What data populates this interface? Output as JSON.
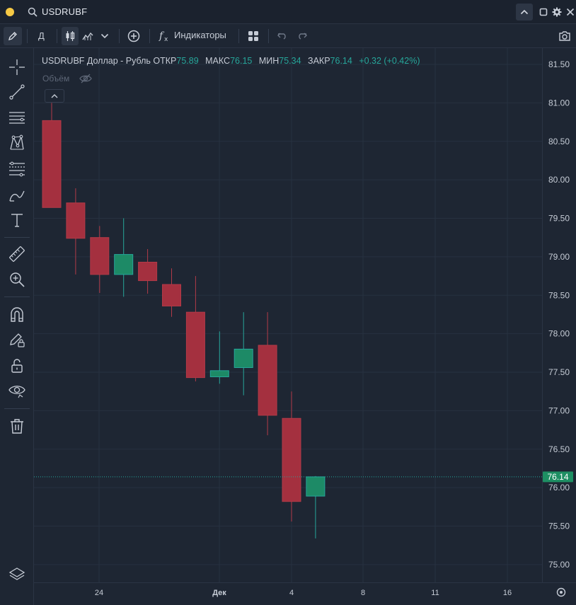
{
  "header": {
    "symbol": "USDRUBF"
  },
  "toolbar": {
    "timeframe": "Д",
    "indicators_label": "Индикаторы"
  },
  "legend": {
    "title": "USDRUBF Доллар - Рубль",
    "open_label": "ОТКР",
    "open_value": "75.89",
    "high_label": "МАКС",
    "high_value": "76.15",
    "low_label": "МИН",
    "low_value": "75.34",
    "close_label": "ЗАКР",
    "close_value": "76.14",
    "change": "+0.32 (+0.42%)",
    "volume_label": "Объём"
  },
  "colors": {
    "up": "#26a69a",
    "down": "#b23a48",
    "background": "#1e2633",
    "grid": "#273140",
    "last_price_tag": "#1e8f63"
  },
  "icons": {
    "top": [
      "search-icon",
      "chevron-up-icon",
      "maximize-icon",
      "settings-icon",
      "close-icon"
    ],
    "toolbar": [
      "pencil-icon",
      "candles-icon",
      "area-chart-icon",
      "chevron-down-icon",
      "plus-circle-icon",
      "fx-icon",
      "layout-grid-icon",
      "undo-icon",
      "redo-icon",
      "camera-icon"
    ],
    "left": [
      "crosshair-icon",
      "trend-line-icon",
      "horizontal-lines-icon",
      "pattern-icon",
      "fib-levels-icon",
      "brush-icon",
      "text-icon",
      "ruler-icon",
      "zoom-icon",
      "magnet-icon",
      "lock-drawing-icon",
      "unlock-icon",
      "eye-icon",
      "trash-icon",
      "layers-icon"
    ]
  },
  "chart_data": {
    "type": "candlestick",
    "symbol": "USDRUBF",
    "y_axis_ticks": [
      "81.50",
      "81.00",
      "80.50",
      "80.00",
      "79.50",
      "79.00",
      "78.50",
      "78.00",
      "77.50",
      "77.00",
      "76.50",
      "76.00",
      "75.50",
      "75.00"
    ],
    "x_axis_ticks": [
      "24",
      "Дек",
      "4",
      "8",
      "11",
      "16"
    ],
    "ylim": [
      75.0,
      81.5
    ],
    "last_price": "76.14",
    "candles": [
      {
        "open": 80.77,
        "high": 81.0,
        "low": 79.64,
        "close": 79.64
      },
      {
        "open": 79.7,
        "high": 79.89,
        "low": 78.77,
        "close": 79.24
      },
      {
        "open": 79.25,
        "high": 79.4,
        "low": 78.53,
        "close": 78.77
      },
      {
        "open": 78.77,
        "high": 79.5,
        "low": 78.48,
        "close": 79.03
      },
      {
        "open": 78.93,
        "high": 79.1,
        "low": 78.52,
        "close": 78.69
      },
      {
        "open": 78.64,
        "high": 78.85,
        "low": 78.22,
        "close": 78.36
      },
      {
        "open": 78.28,
        "high": 78.75,
        "low": 77.38,
        "close": 77.43
      },
      {
        "open": 77.44,
        "high": 78.03,
        "low": 77.35,
        "close": 77.52
      },
      {
        "open": 77.56,
        "high": 78.28,
        "low": 77.2,
        "close": 77.8
      },
      {
        "open": 77.85,
        "high": 78.28,
        "low": 76.68,
        "close": 76.94
      },
      {
        "open": 76.9,
        "high": 77.25,
        "low": 75.56,
        "close": 75.82
      },
      {
        "open": 75.89,
        "high": 76.15,
        "low": 75.34,
        "close": 76.14
      }
    ]
  }
}
